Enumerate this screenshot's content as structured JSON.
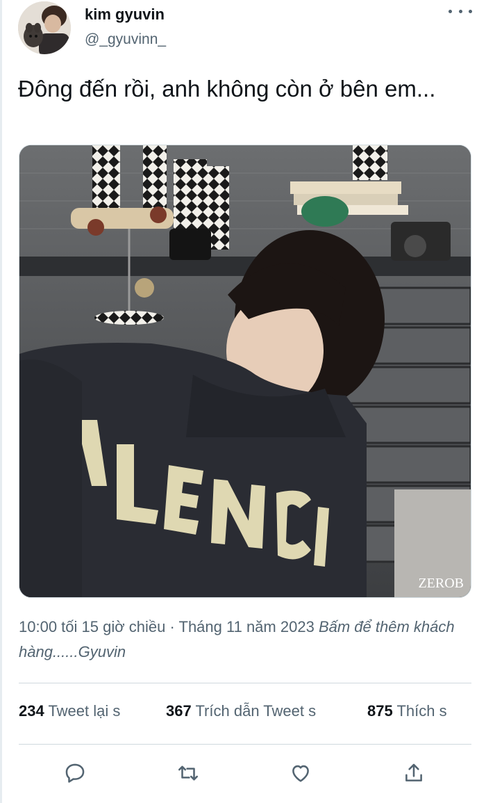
{
  "author": {
    "display_name": "kim gyuvin",
    "handle": "@_gyuvinn_"
  },
  "tweet": {
    "text": "Đông đến rồi, anh không còn ở bên em...",
    "image_watermark": "ZEROB"
  },
  "meta": {
    "timestamp": "10:00 tối 15 giờ chiều · Tháng 11 năm 2023",
    "more_link": "Bấm để thêm khách hàng......Gyuvin"
  },
  "stats": {
    "retweets_count": "234",
    "retweets_label": "Tweet lại s",
    "quotes_count": "367",
    "quotes_label": "Trích dẫn Tweet s",
    "likes_count": "875",
    "likes_label": "Thích s"
  },
  "icons": {
    "more": "more-horizontal-icon",
    "reply": "reply-icon",
    "retweet": "retweet-icon",
    "like": "heart-icon",
    "share": "share-icon"
  },
  "colors": {
    "text_primary": "#0f1419",
    "text_secondary": "#536471",
    "divider": "#cfd9de"
  }
}
